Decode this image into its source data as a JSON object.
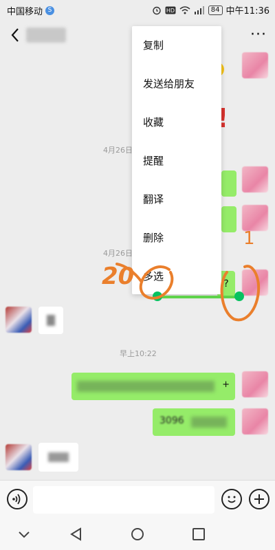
{
  "status_bar": {
    "carrier": "中国移动",
    "network_badge": "S",
    "icons": [
      "alarm-icon",
      "hd-icon",
      "wifi-icon",
      "4g-signal-icon"
    ],
    "battery": "84",
    "time": "中午11:36"
  },
  "nav": {
    "title": "",
    "back_icon": "chevron-left-icon",
    "more_icon": "more-dots-icon"
  },
  "chat": {
    "timestamps": [
      "4月26日",
      "4月26日",
      "早上10:22"
    ],
    "messages": [
      {
        "side": "right",
        "text": ""
      },
      {
        "side": "right",
        "text": ""
      },
      {
        "side": "right",
        "text": "?"
      },
      {
        "side": "left",
        "text": ""
      },
      {
        "side": "right",
        "text": "",
        "suffix": "+"
      },
      {
        "side": "right",
        "text": "3096"
      },
      {
        "side": "left",
        "text": ""
      }
    ],
    "exclaim": "!"
  },
  "context_menu": {
    "items": [
      "复制",
      "发送给朋友",
      "收藏",
      "提醒",
      "翻译",
      "删除",
      "多选"
    ]
  },
  "annotations": {
    "number": "20",
    "mark": "1"
  },
  "input_bar": {
    "voice_icon": "voice-icon",
    "emoji_icon": "emoji-icon",
    "plus_icon": "plus-icon",
    "value": "",
    "placeholder": ""
  },
  "system_nav": {
    "icons": [
      "collapse-chevron-icon",
      "back-triangle-icon",
      "home-circle-icon",
      "recents-square-icon"
    ]
  },
  "colors": {
    "bubble_green": "#95ec69",
    "annotation_orange": "#ea7f2c",
    "selection_green": "#07c160",
    "background": "#ededed"
  }
}
